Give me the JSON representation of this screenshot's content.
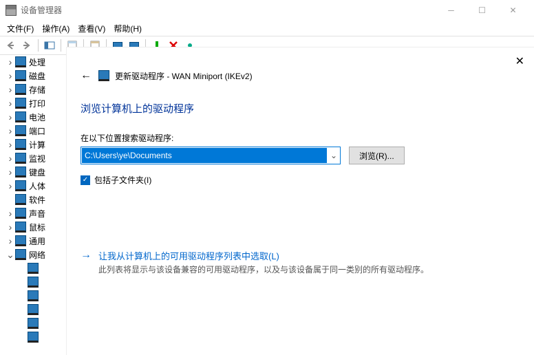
{
  "title": "设备管理器",
  "menu": {
    "file": "文件(F)",
    "action": "操作(A)",
    "view": "查看(V)",
    "help": "帮助(H)"
  },
  "tree": [
    {
      "label": "处理",
      "exp": ">"
    },
    {
      "label": "磁盘",
      "exp": ">"
    },
    {
      "label": "存储",
      "exp": ">"
    },
    {
      "label": "打印",
      "exp": ">"
    },
    {
      "label": "电池",
      "exp": ">"
    },
    {
      "label": "端口",
      "exp": ">"
    },
    {
      "label": "计算",
      "exp": ">"
    },
    {
      "label": "监视",
      "exp": ">"
    },
    {
      "label": "键盘",
      "exp": ">"
    },
    {
      "label": "人体",
      "exp": ">"
    },
    {
      "label": "软件",
      "exp": ""
    },
    {
      "label": "声音",
      "exp": ">"
    },
    {
      "label": "鼠标",
      "exp": ">"
    },
    {
      "label": "通用",
      "exp": ">"
    },
    {
      "label": "网络",
      "exp": "v"
    }
  ],
  "dialog": {
    "title": "更新驱动程序 - WAN Miniport (IKEv2)",
    "heading": "浏览计算机上的驱动程序",
    "search_label": "在以下位置搜索驱动程序:",
    "path": "C:\\Users\\ye\\Documents",
    "browse": "浏览(R)...",
    "include_sub": "包括子文件夹(I)",
    "option_title": "让我从计算机上的可用驱动程序列表中选取(L)",
    "option_desc": "此列表将显示与该设备兼容的可用驱动程序，以及与该设备属于同一类别的所有驱动程序。"
  }
}
